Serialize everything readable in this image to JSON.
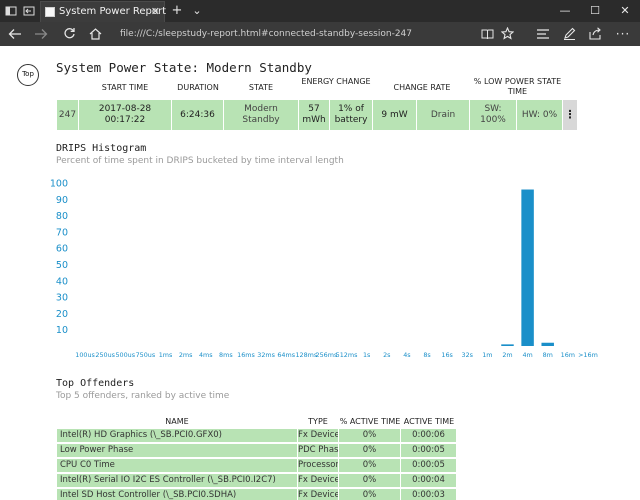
{
  "window": {
    "tab_title": "System Power Report",
    "new_tab_label": "+",
    "tab_menu_label": "⌄",
    "minimize_label": "—",
    "maximize_label": "☐",
    "close_label": "✕"
  },
  "nav": {
    "address": "file:///C:/sleepstudy-report.html#connected-standby-session-247"
  },
  "page": {
    "top_link": "Top",
    "title": "System Power State: Modern Standby"
  },
  "session_table": {
    "headers": {
      "start_time": "START TIME",
      "duration": "DURATION",
      "state": "STATE",
      "energy_change": "ENERGY CHANGE",
      "change_rate": "CHANGE RATE",
      "low_power": "% LOW POWER STATE TIME"
    },
    "row": {
      "id": "247",
      "start_time": "2017-08-28 00:17:22",
      "duration": "6:24:36",
      "state": "Modern Standby",
      "energy": "57 mWh",
      "battery": "1% of battery",
      "rate": "9 mW",
      "direction": "Drain",
      "sw": "SW: 100%",
      "hw": "HW: 0%",
      "menu": "⋮"
    }
  },
  "drips": {
    "title": "DRIPS Histogram",
    "subtitle": "Percent of time spent in DRIPS bucketed by time interval length"
  },
  "chart_data": {
    "type": "bar",
    "title": "",
    "xlabel": "",
    "ylabel": "",
    "ylim": [
      0,
      100
    ],
    "yticks": [
      10,
      20,
      30,
      40,
      50,
      60,
      70,
      80,
      90,
      100
    ],
    "grid": false,
    "categories": [
      "100us",
      "250us",
      "500us",
      "750us",
      "1ms",
      "2ms",
      "4ms",
      "8ms",
      "16ms",
      "32ms",
      "64ms",
      "128ms",
      "256ms",
      "512ms",
      "1s",
      "2s",
      "4s",
      "8s",
      "16s",
      "32s",
      "1m",
      "2m",
      "4m",
      "8m",
      "16m",
      ">16m"
    ],
    "values": [
      0,
      0,
      0,
      0,
      0,
      0,
      0,
      0,
      0,
      0,
      0,
      0,
      0,
      0,
      0,
      0,
      0,
      0,
      0,
      0,
      0,
      1,
      96,
      2,
      0,
      0
    ],
    "bar_color": "#1a8fc9",
    "tick_color": "#1a8fc9"
  },
  "offenders": {
    "title": "Top Offenders",
    "subtitle": "Top 5 offenders, ranked by active time",
    "headers": {
      "name": "NAME",
      "type": "TYPE",
      "pct": "% ACTIVE TIME",
      "active": "ACTIVE TIME"
    },
    "rows": [
      {
        "name": "Intel(R) HD Graphics (\\_SB.PCI0.GFX0)",
        "type": "Fx Device",
        "pct": "0%",
        "time": "0:00:06"
      },
      {
        "name": "Low Power Phase",
        "type": "PDC Phase",
        "pct": "0%",
        "time": "0:00:05"
      },
      {
        "name": "CPU C0 Time",
        "type": "Processor",
        "pct": "0%",
        "time": "0:00:05"
      },
      {
        "name": "Intel(R) Serial IO I2C ES Controller (\\_SB.PCI0.I2C7)",
        "type": "Fx Device",
        "pct": "0%",
        "time": "0:00:04"
      },
      {
        "name": "Intel SD Host Controller (\\_SB.PCI0.SDHA)",
        "type": "Fx Device",
        "pct": "0%",
        "time": "0:00:03"
      }
    ]
  },
  "colors": {
    "row_green": "#b8e3b4",
    "title_bar": "#2b2b2b",
    "nav_bar": "#3a3a3a"
  }
}
